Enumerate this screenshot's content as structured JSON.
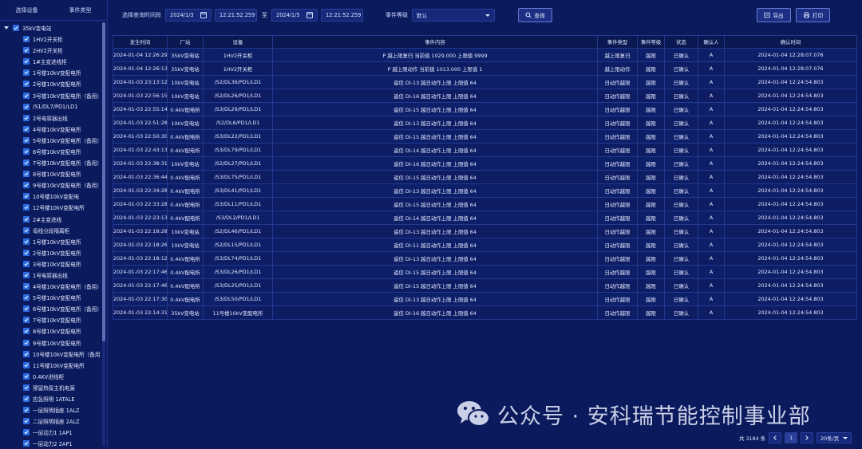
{
  "sidebar": {
    "tab_device": "选择设备",
    "tab_event_type": "事件类型",
    "root_label": "35kV变电站",
    "items": [
      "1HV2开关柜",
      "2HV2开关柜",
      "1#主变进线柜",
      "1号楼10kV变配电所",
      "2号楼10kV变配电所",
      "3号楼10kV变配电所（备用）",
      "/S1/DL7/PD1/LD1",
      "2号电容器出线",
      "4号楼10kV变配电所",
      "5号楼10kV变配电所（备用）",
      "6号楼10kV变配电所",
      "7号楼10kV变配电所（备用）",
      "8号楼10kV变配电所",
      "9号楼10kV变配电所（备用）",
      "10号楼10kV变配电",
      "12号楼10kV变配电所",
      "2#主变进线",
      "母线分段隔离柜",
      "1号楼10kV变配电所",
      "2号楼10kV变配电所",
      "3号楼10kV变配电所",
      "1号电容器出线",
      "4号楼10kV变配电所（备用）",
      "5号楼10kV变配电所",
      "6号楼10kV变配电所（备用）",
      "7号楼10kV变配电所",
      "8号楼10kV变配电所",
      "9号楼10kV变配电所",
      "10号楼10kV变配电所（备用）",
      "11号楼10kV变配电所",
      "0.4KV进线柜",
      "预留热泵主机电源",
      "应急照明 1ATALE",
      "一层照明插座 1ALZ",
      "二层照明插座 2ALZ",
      "一层动力1 1AP1",
      "一层动力2 2AP1"
    ]
  },
  "toolbar": {
    "query_time_label": "选择查询时间段",
    "start_date": "2024/1/3",
    "start_time": "12:21:52.259",
    "to_label": "至",
    "end_date": "2024/1/5",
    "end_time": "12:21:52.259",
    "event_level_label": "事件等级",
    "event_level_value": "默认",
    "query_button": "查询",
    "export_button": "导出",
    "print_button": "打印"
  },
  "table": {
    "headers": [
      "发生时间",
      "厂站",
      "设备",
      "事件内容",
      "事件类型",
      "事件等级",
      "状态",
      "确认人",
      "确认时间"
    ],
    "rows": [
      [
        "2024-01-04 12:26:29.654",
        "35kV变电站",
        "1HV2开关柜",
        "P 越上限复归 当前值 1029.000 上限值 9999",
        "越上限复归",
        "越限",
        "已确认",
        "A",
        "2024-01-04 12:28:07.076"
      ],
      [
        "2024-01-04 12:26:13.842",
        "35kV变电站",
        "1HV2开关柜",
        "P 越上限动作 当前值 1013.000 上限值 1",
        "越上限动作",
        "越限",
        "已确认",
        "A",
        "2024-01-04 12:28:07.076"
      ],
      [
        "2024-01-03 23:13:12.113",
        "10kV变电站",
        "/S2/DL36/PD1/LD1",
        "遥信 DI-13 越日动作上限 上限值 64",
        "日动作越限",
        "越限",
        "已确认",
        "A",
        "2024-01-04 12:24:54.803"
      ],
      [
        "2024-01-03 22:56:15.365",
        "10kV变电站",
        "/S2/DL26/PD1/LD1",
        "遥信 DI-16 越日动作上限 上限值 64",
        "日动作越限",
        "越限",
        "已确认",
        "A",
        "2024-01-04 12:24:54.803"
      ],
      [
        "2024-01-03 22:55:14.114",
        "0.4kV配电所",
        "/S3/DL29/PD1/LD1",
        "遥信 DI-15 越日动作上限 上限值 64",
        "日动作越限",
        "越限",
        "已确认",
        "A",
        "2024-01-04 12:24:54.803"
      ],
      [
        "2024-01-03 22:51:28.924",
        "10kV变电站",
        "/S2/DL6/PD1/LD1",
        "遥信 DI-13 越日动作上限 上限值 64",
        "日动作越限",
        "越限",
        "已确认",
        "A",
        "2024-01-04 12:24:54.803"
      ],
      [
        "2024-01-03 22:50:30.441",
        "0.4kV配电所",
        "/S3/DL22/PD1/LD1",
        "遥信 DI-15 越日动作上限 上限值 64",
        "日动作越限",
        "越限",
        "已确认",
        "A",
        "2024-01-04 12:24:54.803"
      ],
      [
        "2024-01-03 22:43:13.061",
        "0.4kV配电所",
        "/S3/DL79/PD1/LD1",
        "遥信 DI-14 越日动作上限 上限值 64",
        "日动作越限",
        "越限",
        "已确认",
        "A",
        "2024-01-04 12:24:54.803"
      ],
      [
        "2024-01-03 22:38:31.753",
        "10kV变电站",
        "/S2/DL27/PD1/LD1",
        "遥信 DI-16 越日动作上限 上限值 64",
        "日动作越限",
        "越限",
        "已确认",
        "A",
        "2024-01-04 12:24:54.803"
      ],
      [
        "2024-01-03 22:36:44.940",
        "0.4kV配电所",
        "/S3/DL75/PD1/LD1",
        "遥信 DI-15 越日动作上限 上限值 64",
        "日动作越限",
        "越限",
        "已确认",
        "A",
        "2024-01-04 12:24:54.803"
      ],
      [
        "2024-01-03 22:34:28.667",
        "0.4kV配电所",
        "/S3/DL41/PD1/LD1",
        "遥信 DI-13 越日动作上限 上限值 64",
        "日动作越限",
        "越限",
        "已确认",
        "A",
        "2024-01-04 12:24:54.803"
      ],
      [
        "2024-01-03 22:33:28.073",
        "0.4kV配电所",
        "/S3/DL11/PD1/LD1",
        "遥信 DI-15 越日动作上限 上限值 64",
        "日动作越限",
        "越限",
        "已确认",
        "A",
        "2024-01-04 12:24:54.803"
      ],
      [
        "2024-01-03 22:23:13.156",
        "0.4kV配电所",
        "/S3/DL2/PD1/LD1",
        "遥信 DI-14 越日动作上限 上限值 64",
        "日动作越限",
        "越限",
        "已确认",
        "A",
        "2024-01-04 12:24:54.803"
      ],
      [
        "2024-01-03 22:18:28.078",
        "10kV变电站",
        "/S2/DL46/PD1/LD1",
        "遥信 DI-13 越日动作上限 上限值 64",
        "日动作越限",
        "越限",
        "已确认",
        "A",
        "2024-01-04 12:24:54.803"
      ],
      [
        "2024-01-03 22:18:26.052",
        "10kV变电站",
        "/S2/DL15/PD1/LD1",
        "遥信 DI-11 越日动作上限 上限值 64",
        "日动作越限",
        "越限",
        "已确认",
        "A",
        "2024-01-04 12:24:54.803"
      ],
      [
        "2024-01-03 22:18:12.233",
        "0.4kV配电所",
        "/S3/DL74/PD1/LD1",
        "遥信 DI-13 越日动作上限 上限值 64",
        "日动作越限",
        "越限",
        "已确认",
        "A",
        "2024-01-04 12:24:54.803"
      ],
      [
        "2024-01-03 22:17:46.959",
        "0.4kV配电所",
        "/S3/DL26/PD1/LD1",
        "遥信 DI-15 越日动作上限 上限值 64",
        "日动作越限",
        "越限",
        "已确认",
        "A",
        "2024-01-04 12:24:54.803"
      ],
      [
        "2024-01-03 22:17:46.665",
        "0.4kV配电所",
        "/S3/DL25/PD1/LD1",
        "遥信 DI-15 越日动作上限 上限值 64",
        "日动作越限",
        "越限",
        "已确认",
        "A",
        "2024-01-04 12:24:54.803"
      ],
      [
        "2024-01-03 22:17:30.004",
        "0.4kV配电所",
        "/S3/DL50/PD1/LD1",
        "遥信 DI-13 越日动作上限 上限值 64",
        "日动作越限",
        "越限",
        "已确认",
        "A",
        "2024-01-04 12:24:54.803"
      ],
      [
        "2024-01-03 22:14:31.659",
        "35kV变电站",
        "11号楼10kV变配电所",
        "遥信 DI-16 越日动作上限 上限值 64",
        "日动作越限",
        "越限",
        "已确认",
        "A",
        "2024-01-04 12:24:54.803"
      ]
    ]
  },
  "pagination": {
    "total_text": "共 3184 条",
    "current_page": "1",
    "page_size": "20条/页"
  },
  "watermark": {
    "text": "公众号 · 安科瑞节能控制事业部",
    "icon": "wechat-icon"
  },
  "colors": {
    "background": "#0b1a5c",
    "checkbox": "#2d6ce0",
    "border": "#23388f"
  }
}
